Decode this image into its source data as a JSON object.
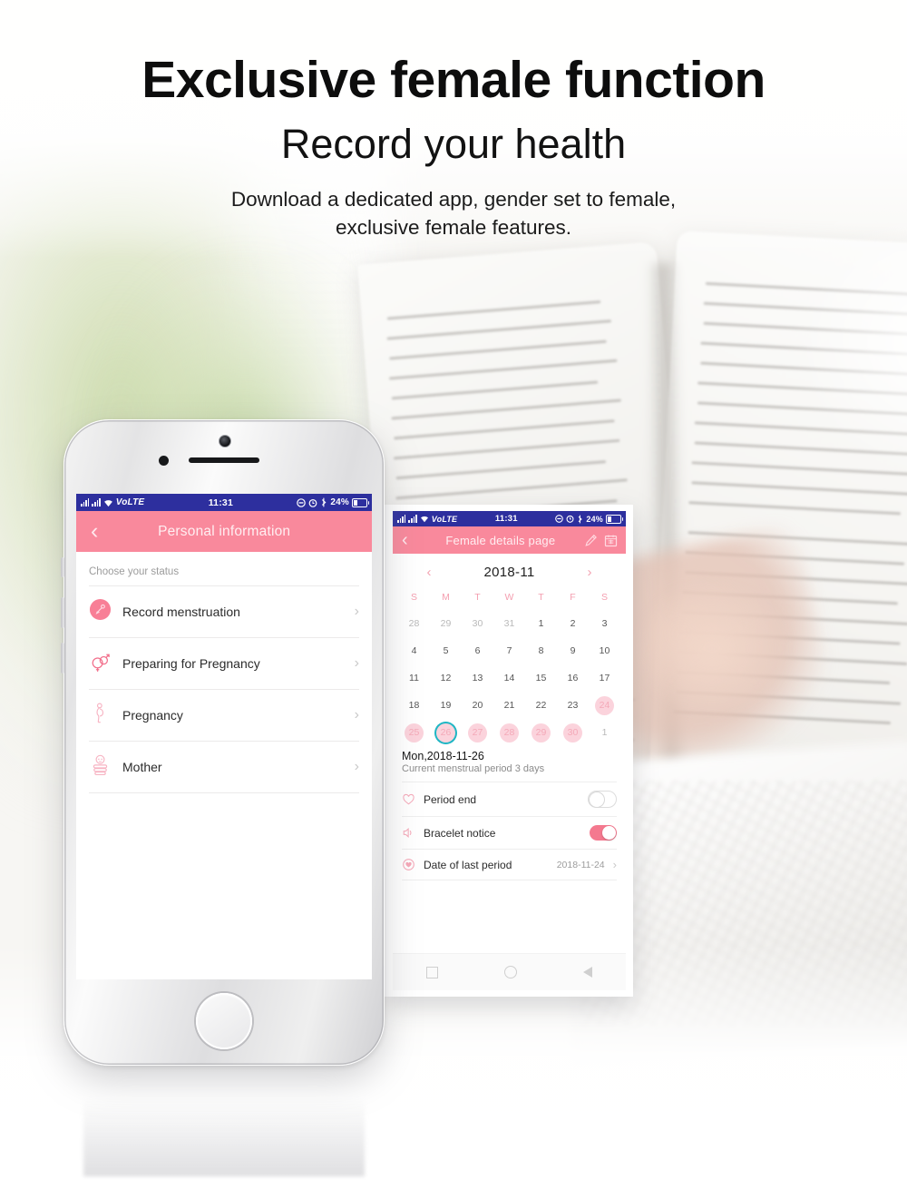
{
  "headline": {
    "title": "Exclusive female function",
    "subtitle": "Record your health",
    "description_line1": "Download a dedicated app, gender set to female,",
    "description_line2": "exclusive female features."
  },
  "colors": {
    "brand_pink": "#f9899c",
    "toggle_on": "#f4798f",
    "period_day": "#fbd3dc",
    "selected_ring": "#1fb6c4",
    "statusbar": "#2d2f9e"
  },
  "phone1": {
    "statusbar": {
      "carrier": "VoLTE",
      "time": "11:31",
      "battery_percent": "24%",
      "icons": [
        "signal-bars-icon",
        "signal-bars-icon",
        "wifi-icon",
        "dnd-icon",
        "alarm-icon",
        "bluetooth-icon",
        "battery-icon"
      ]
    },
    "navbar": {
      "back_icon": "chevron-left-icon",
      "title": "Personal information"
    },
    "section_label": "Choose your status",
    "items": [
      {
        "icon": "menstruation-icon",
        "label": "Record menstruation",
        "chevron": "chevron-right-icon",
        "active": true
      },
      {
        "icon": "gender-symbols-icon",
        "label": "Preparing for Pregnancy",
        "chevron": "chevron-right-icon",
        "active": false
      },
      {
        "icon": "pregnant-woman-icon",
        "label": "Pregnancy",
        "chevron": "chevron-right-icon",
        "active": false
      },
      {
        "icon": "baby-icon",
        "label": "Mother",
        "chevron": "chevron-right-icon",
        "active": false
      }
    ]
  },
  "phone2": {
    "statusbar": {
      "carrier": "VoLTE",
      "time": "11:31",
      "battery_percent": "24%"
    },
    "navbar": {
      "back_icon": "chevron-left-icon",
      "title": "Female details page",
      "action_icons": [
        "pen-edit-icon",
        "calendar-icon"
      ]
    },
    "calendar": {
      "prev_icon": "chevron-left-icon",
      "next_icon": "chevron-right-icon",
      "month_label": "2018-11",
      "weekdays": [
        "S",
        "M",
        "T",
        "W",
        "T",
        "F",
        "S"
      ],
      "weeks": [
        [
          {
            "d": "28",
            "state": "outside"
          },
          {
            "d": "29",
            "state": "outside"
          },
          {
            "d": "30",
            "state": "outside"
          },
          {
            "d": "31",
            "state": "outside"
          },
          {
            "d": "1",
            "state": "normal"
          },
          {
            "d": "2",
            "state": "normal"
          },
          {
            "d": "3",
            "state": "normal"
          }
        ],
        [
          {
            "d": "4",
            "state": "normal"
          },
          {
            "d": "5",
            "state": "normal"
          },
          {
            "d": "6",
            "state": "normal"
          },
          {
            "d": "7",
            "state": "normal"
          },
          {
            "d": "8",
            "state": "normal"
          },
          {
            "d": "9",
            "state": "normal"
          },
          {
            "d": "10",
            "state": "normal"
          }
        ],
        [
          {
            "d": "11",
            "state": "normal"
          },
          {
            "d": "12",
            "state": "normal"
          },
          {
            "d": "13",
            "state": "normal"
          },
          {
            "d": "14",
            "state": "normal"
          },
          {
            "d": "15",
            "state": "normal"
          },
          {
            "d": "16",
            "state": "normal"
          },
          {
            "d": "17",
            "state": "normal"
          }
        ],
        [
          {
            "d": "18",
            "state": "normal"
          },
          {
            "d": "19",
            "state": "normal"
          },
          {
            "d": "20",
            "state": "normal"
          },
          {
            "d": "21",
            "state": "normal"
          },
          {
            "d": "22",
            "state": "normal"
          },
          {
            "d": "23",
            "state": "normal"
          },
          {
            "d": "24",
            "state": "period"
          }
        ],
        [
          {
            "d": "25",
            "state": "period"
          },
          {
            "d": "26",
            "state": "period-selected"
          },
          {
            "d": "27",
            "state": "period"
          },
          {
            "d": "28",
            "state": "period"
          },
          {
            "d": "29",
            "state": "period"
          },
          {
            "d": "30",
            "state": "period"
          },
          {
            "d": "1",
            "state": "outside"
          }
        ]
      ]
    },
    "detail": {
      "date": "Mon,2018-11-26",
      "status": "Current menstrual period 3 days",
      "rows": [
        {
          "icon": "heart-outline-icon",
          "label": "Period end",
          "control": "toggle",
          "value": "off"
        },
        {
          "icon": "speaker-icon",
          "label": "Bracelet notice",
          "control": "toggle",
          "value": "on"
        },
        {
          "icon": "heart-shield-icon",
          "label": "Date of last period",
          "control": "value",
          "value": "2018-11-24",
          "chevron": "chevron-right-icon"
        }
      ]
    },
    "androidnav": [
      "recents-square-icon",
      "home-circle-icon",
      "back-triangle-icon"
    ]
  }
}
